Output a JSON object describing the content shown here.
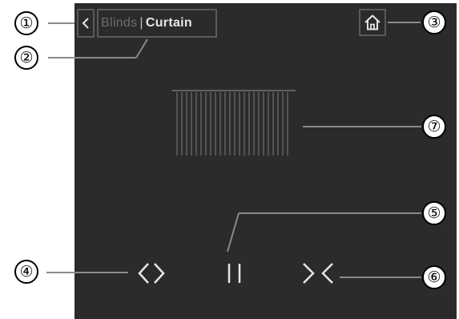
{
  "top_bar": {
    "back_icon": "chevron-left-icon",
    "tabs": [
      {
        "label": "Blinds",
        "state": "inactive"
      },
      {
        "label": "Curtain",
        "state": "active"
      }
    ],
    "separator": "|",
    "home_icon": "home-icon"
  },
  "controls": {
    "open_icon": "open-chevrons-icon",
    "pause_icon": "pause-icon",
    "close_icon": "close-chevrons-icon"
  },
  "curtain_icon": "curtain-icon",
  "callouts": [
    "①",
    "②",
    "③",
    "④",
    "⑤",
    "⑥",
    "⑦"
  ],
  "colors": {
    "panel_bg": "#2b2b2b",
    "active_text": "#e8e8e8",
    "inactive_text": "#6d6d6d",
    "icon": "#e6e6e6",
    "button_border": "#5a5a5a"
  }
}
